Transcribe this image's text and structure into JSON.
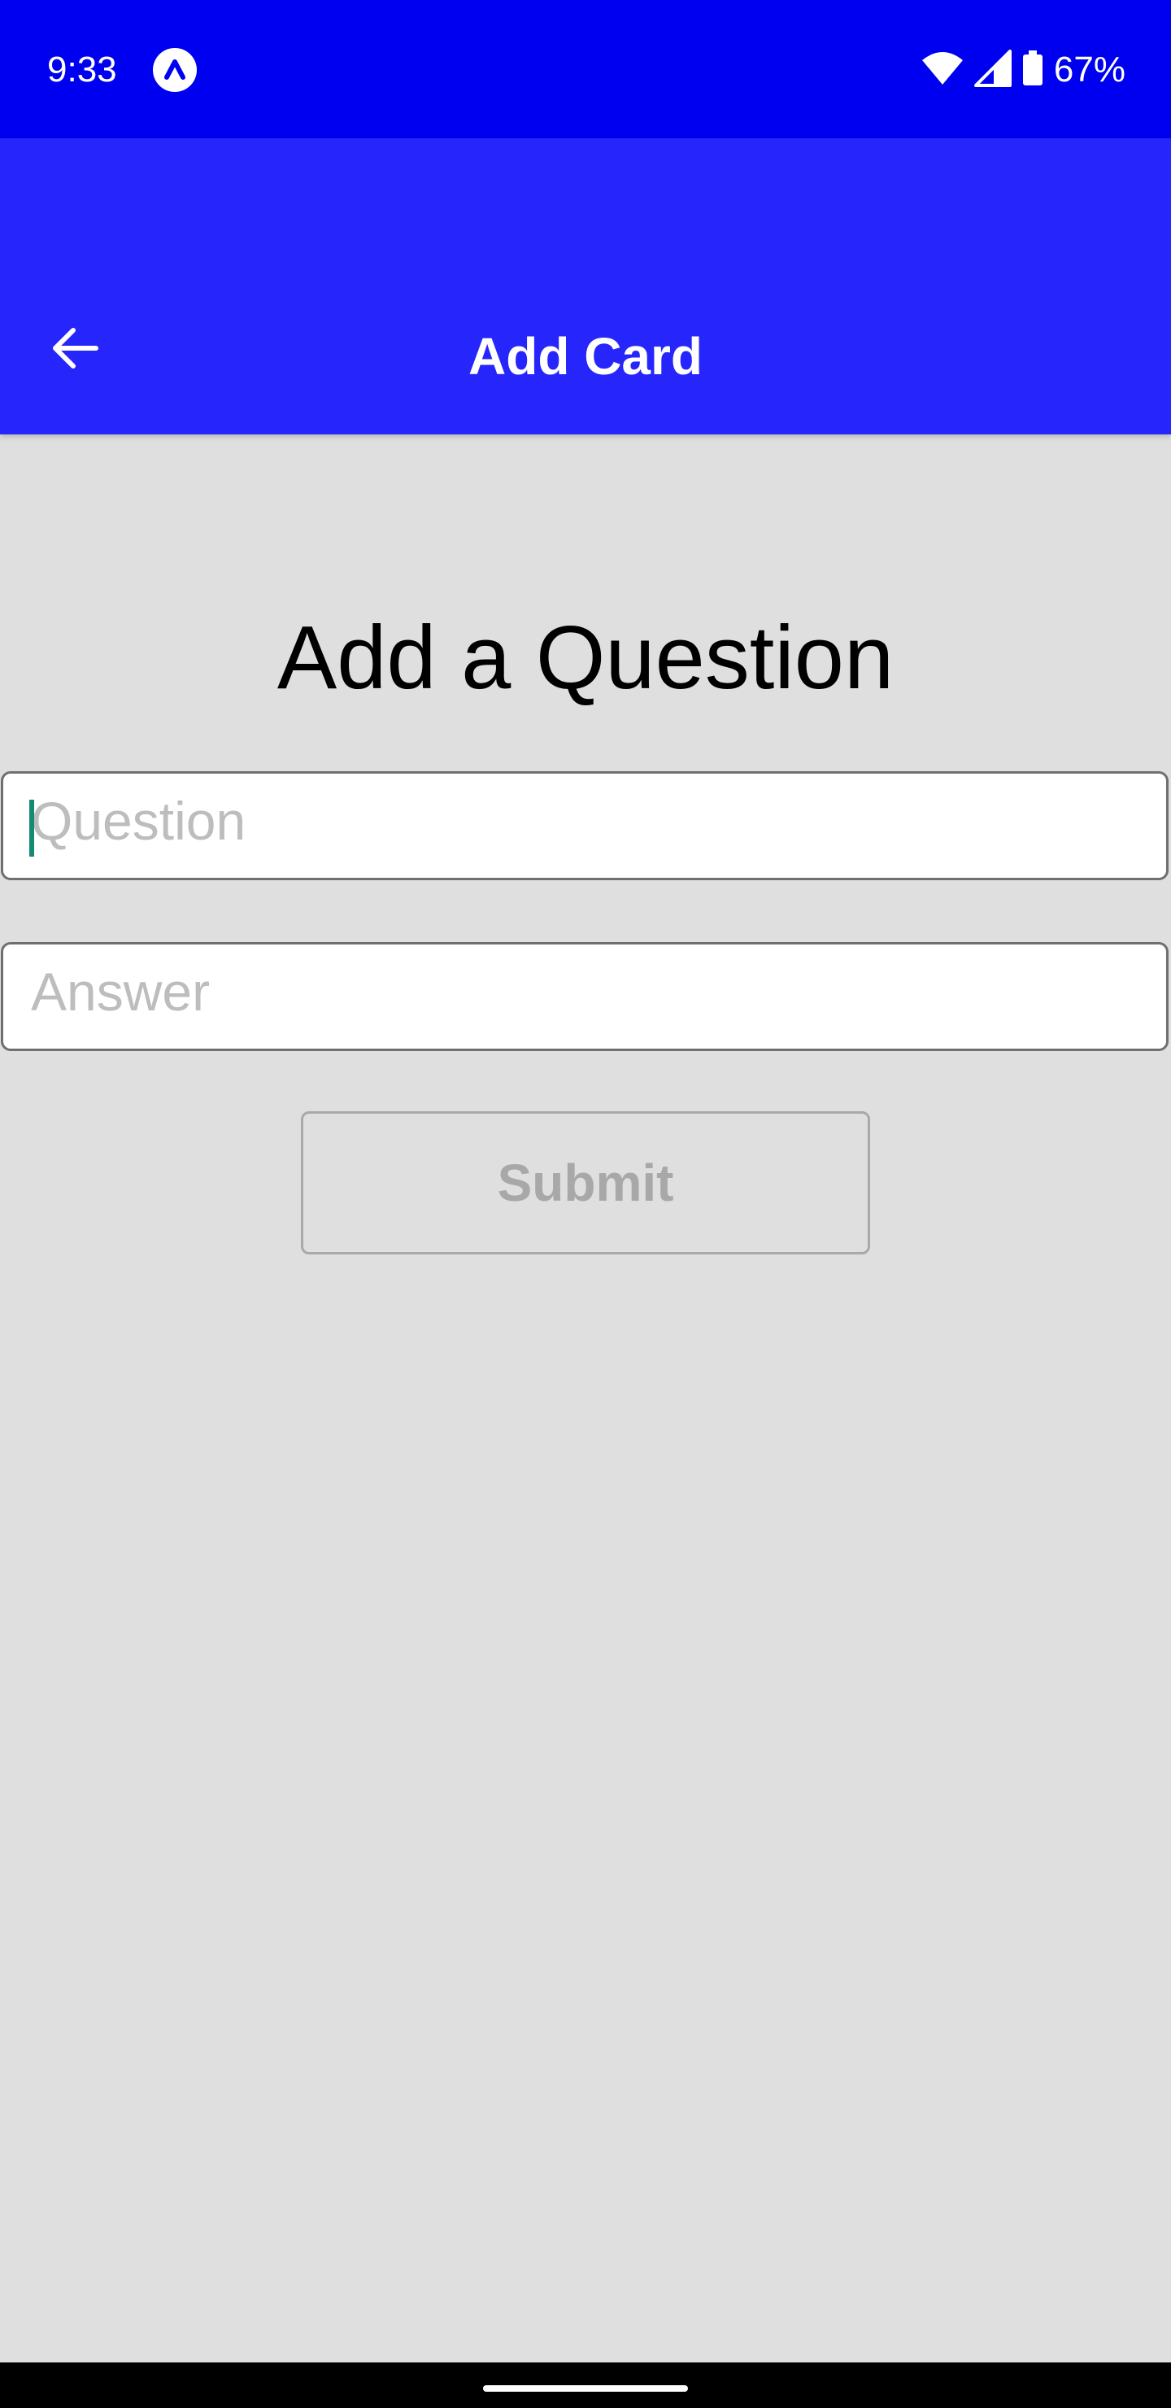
{
  "status_bar": {
    "time": "9:33",
    "battery": "67%",
    "icons": [
      "app-notification-icon",
      "wifi-icon",
      "signal-icon",
      "battery-icon"
    ]
  },
  "app_bar": {
    "title": "Add Card",
    "back_icon": "arrow-back-icon"
  },
  "main": {
    "heading": "Add a Question",
    "question_placeholder": "Question",
    "answer_placeholder": "Answer",
    "submit_label": "Submit"
  },
  "colors": {
    "status_bar": "#0000f0",
    "app_bar": "#2626fc",
    "background": "#dfdfdf",
    "cursor": "#138a72"
  }
}
